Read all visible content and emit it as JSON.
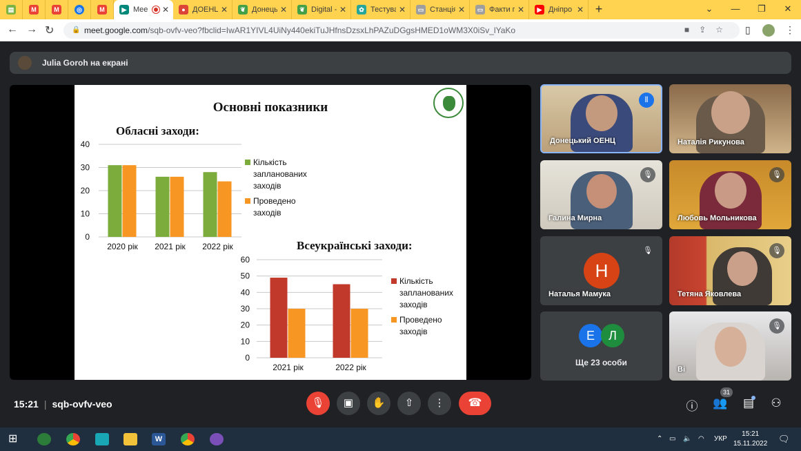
{
  "browser": {
    "tabs": [
      {
        "title": "",
        "icon": "file-icon",
        "color": "#7cb342"
      },
      {
        "title": "",
        "icon": "gmail-icon",
        "color": "#ea4335"
      },
      {
        "title": "",
        "icon": "gmail-icon",
        "color": "#ea4335"
      },
      {
        "title": "",
        "icon": "chrome-icon",
        "color": "#1a73e8"
      },
      {
        "title": "",
        "icon": "gmail-icon",
        "color": "#ea4335"
      },
      {
        "title": "Mee",
        "icon": "meet-icon",
        "color": "#00897b",
        "active": true
      },
      {
        "title": "ДОЕНЦ",
        "icon": "maps-pin-icon",
        "color": "#db4437"
      },
      {
        "title": "Донецьк",
        "icon": "site-icon",
        "color": "#43a047"
      },
      {
        "title": "Digital -",
        "icon": "site-icon",
        "color": "#43a047"
      },
      {
        "title": "Тестуван",
        "icon": "flower-icon",
        "color": "#26a69a"
      },
      {
        "title": "Станція",
        "icon": "slides-icon",
        "color": "#9e9e9e"
      },
      {
        "title": "Факти пр",
        "icon": "slides-icon",
        "color": "#9e9e9e"
      },
      {
        "title": "Дніпро",
        "icon": "youtube-icon",
        "color": "#ff0000"
      }
    ],
    "url_domain": "meet.google.com",
    "url_path": "/sqb-ovfv-veo?fbclid=IwAR1YIVL4UiNy440ekiTuJHfnsDzsxLhPAZuDGgsHMED1oWM3X0iSv_lYaKo"
  },
  "presenter": {
    "text": "Julia Goroh на екрані"
  },
  "slide": {
    "title": "Основні показники",
    "chart1_title": "Обласні заходи:",
    "chart2_title": "Всеукраїнські заходи:"
  },
  "chart_data": [
    {
      "type": "bar",
      "title": "Обласні заходи:",
      "categories": [
        "2020 рік",
        "2021 рік",
        "2022 рік"
      ],
      "series": [
        {
          "name": "Кількість запланованих заходів",
          "values": [
            31,
            26,
            28
          ],
          "color": "#7cac3c"
        },
        {
          "name": "Проведено заходів",
          "values": [
            31,
            26,
            24
          ],
          "color": "#f79623"
        }
      ],
      "ylim": [
        0,
        40
      ],
      "yticks": [
        0,
        10,
        20,
        30,
        40
      ],
      "grid": true,
      "legend": "right"
    },
    {
      "type": "bar",
      "title": "Всеукраїнські заходи:",
      "categories": [
        "2021 рік",
        "2022 рік"
      ],
      "series": [
        {
          "name": "Кількість запланованих заходів",
          "values": [
            49,
            45
          ],
          "color": "#c0392b"
        },
        {
          "name": "Проведено заходів",
          "values": [
            30,
            30
          ],
          "color": "#f79623"
        }
      ],
      "ylim": [
        0,
        60
      ],
      "yticks": [
        0,
        10,
        20,
        30,
        40,
        50,
        60
      ],
      "grid": true,
      "legend": "right"
    }
  ],
  "participants": [
    {
      "name": "Донецький ОЕНЦ",
      "status": "speaking"
    },
    {
      "name": "Наталія Рикунова",
      "status": "video"
    },
    {
      "name": "Галина Мирна",
      "status": "muted"
    },
    {
      "name": "Любовь Мольникова",
      "status": "muted"
    },
    {
      "name": "Наталья Мамука",
      "status": "muted",
      "initial": "Н"
    },
    {
      "name": "Тетяна Яковлева",
      "status": "muted"
    },
    {
      "name": "Ще 23 особи",
      "initials": [
        "Е",
        "Л"
      ]
    },
    {
      "name": "Ві",
      "status": "muted"
    }
  ],
  "meeting": {
    "time": "15:21",
    "code": "sqb-ovfv-veo",
    "participants_count": "31"
  },
  "taskbar": {
    "lang": "УКР",
    "time": "15:21",
    "date": "15.11.2022"
  }
}
